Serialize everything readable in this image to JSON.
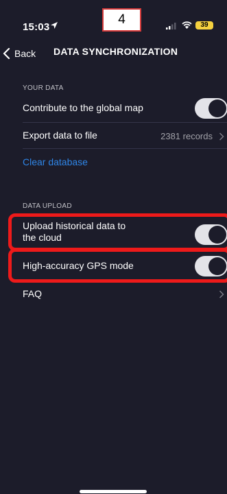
{
  "status_bar": {
    "time": "15:03",
    "overlay_label": "4",
    "battery_level": "39"
  },
  "nav": {
    "back_label": "Back",
    "title": "DATA SYNCHRONIZATION"
  },
  "sections": {
    "your_data": {
      "header": "YOUR DATA",
      "contribute_label": "Contribute to the global map",
      "contribute_on": true,
      "export_label": "Export data to file",
      "export_value": "2381 records",
      "clear_label": "Clear database"
    },
    "data_upload": {
      "header": "DATA UPLOAD",
      "upload_label_line1": "Upload historical data to",
      "upload_label_line2": "the cloud",
      "upload_on": true,
      "gps_label": "High-accuracy GPS mode",
      "gps_on": true,
      "faq_label": "FAQ"
    }
  },
  "colors": {
    "background": "#1c1c2a",
    "link": "#2f86e8",
    "highlight": "#ee1a1a",
    "toggle_on": "#e3e3e8"
  },
  "icons": [
    "location-arrow-icon",
    "signal-icon",
    "wifi-icon",
    "battery-icon",
    "chevron-left-icon",
    "chevron-right-icon"
  ]
}
